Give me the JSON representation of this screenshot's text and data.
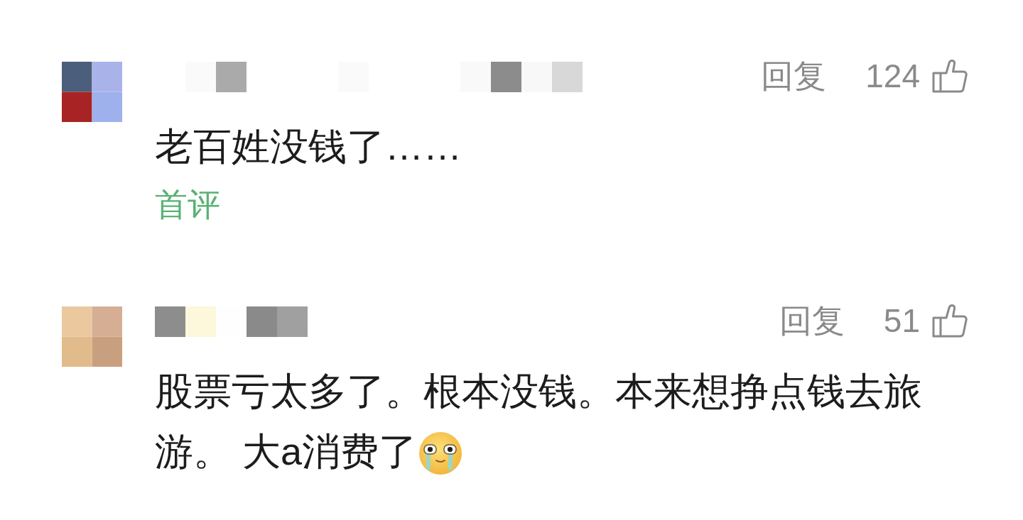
{
  "comments": [
    {
      "reply": "回复",
      "likes": "124",
      "lines": [
        "老百姓没钱了……"
      ],
      "tag": "首评"
    },
    {
      "reply": "回复",
      "likes": "51",
      "lines": [
        "股票亏太多了。根本没钱。本来想挣点钱去旅",
        "游。 大a消费了"
      ],
      "emoji": {
        "kind": "crying"
      }
    }
  ]
}
